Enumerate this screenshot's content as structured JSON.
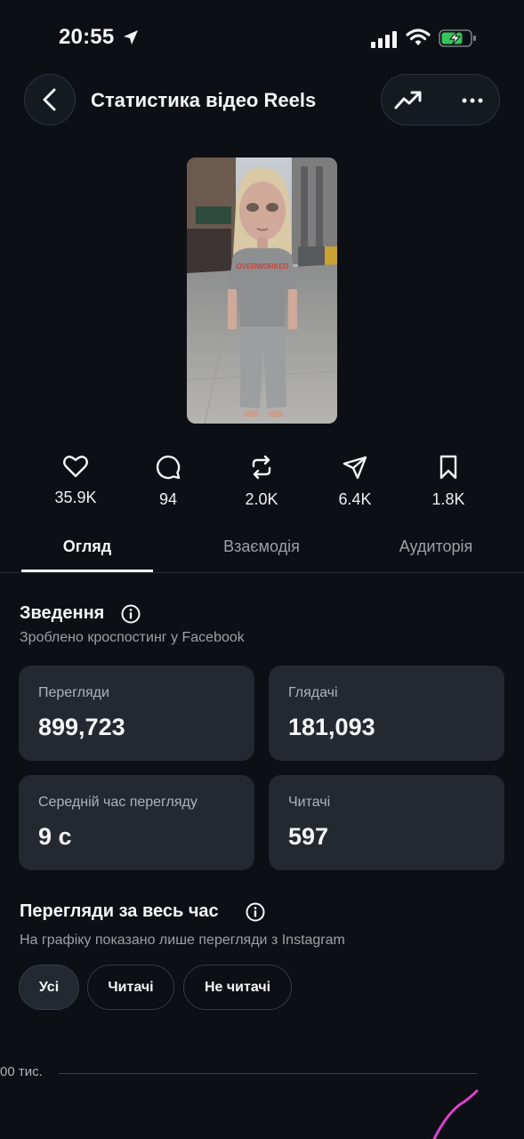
{
  "status_bar": {
    "time": "20:55"
  },
  "header": {
    "title": "Статистика відео Reels"
  },
  "thumbnail": {
    "shirt_text": "OVERWORKED"
  },
  "stats": [
    {
      "icon": "heart-icon",
      "value": "35.9K"
    },
    {
      "icon": "comment-icon",
      "value": "94"
    },
    {
      "icon": "repost-icon",
      "value": "2.0K"
    },
    {
      "icon": "send-icon",
      "value": "6.4K"
    },
    {
      "icon": "bookmark-icon",
      "value": "1.8K"
    }
  ],
  "tabs": [
    {
      "label": "Огляд",
      "active": true
    },
    {
      "label": "Взаємодія",
      "active": false
    },
    {
      "label": "Аудиторія",
      "active": false
    }
  ],
  "summary": {
    "title": "Зведення",
    "subtitle": "Зроблено кроспостинг у Facebook",
    "cards": [
      {
        "label": "Перегляди",
        "value": "899,723"
      },
      {
        "label": "Глядачі",
        "value": "181,093"
      },
      {
        "label": "Середній час перегляду",
        "value": "9 с"
      },
      {
        "label": "Читачі",
        "value": "597"
      }
    ]
  },
  "all_time": {
    "title": "Перегляди за весь час",
    "subtitle": "На графіку показано лише перегляди з Instagram",
    "filters": [
      {
        "label": "Усі",
        "selected": true
      },
      {
        "label": "Читачі",
        "selected": false
      },
      {
        "label": "Не читачі",
        "selected": false
      }
    ],
    "axis_label": "00 тис."
  },
  "colors": {
    "background": "#0c0f14",
    "card": "#232831",
    "chart_line": "#e040d0",
    "battery": "#34c759"
  }
}
